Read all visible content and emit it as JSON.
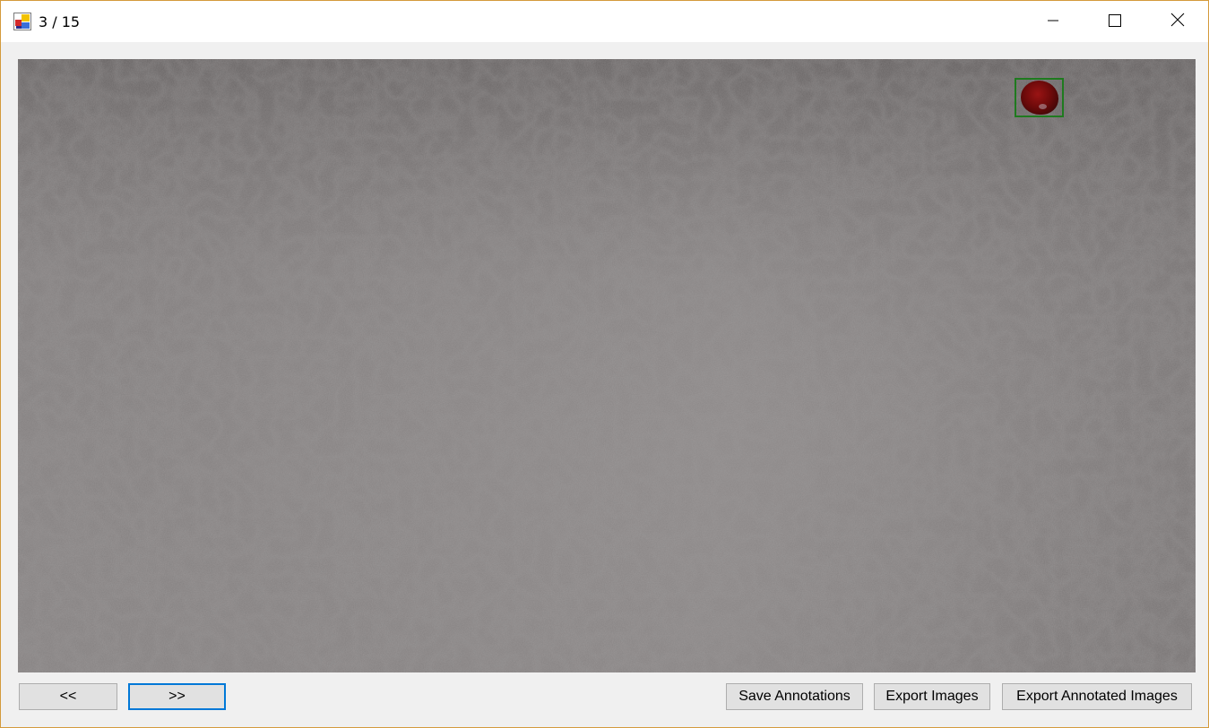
{
  "window": {
    "title": "3 / 15"
  },
  "title_bar_controls": {
    "minimize_icon": "minimize-icon",
    "maximize_icon": "maximize-icon",
    "close_icon": "close-icon"
  },
  "viewer": {
    "image_description_icon": "textured-wall-image",
    "annotation_color": "#1f7a1f"
  },
  "buttons": {
    "prev_label": "<<",
    "next_label": ">>",
    "save_label": "Save Annotations",
    "export_label": "Export Images",
    "export_annotated_label": "Export Annotated Images"
  },
  "colors": {
    "focus_border": "#0078d7",
    "window_border": "#d49a3c"
  }
}
